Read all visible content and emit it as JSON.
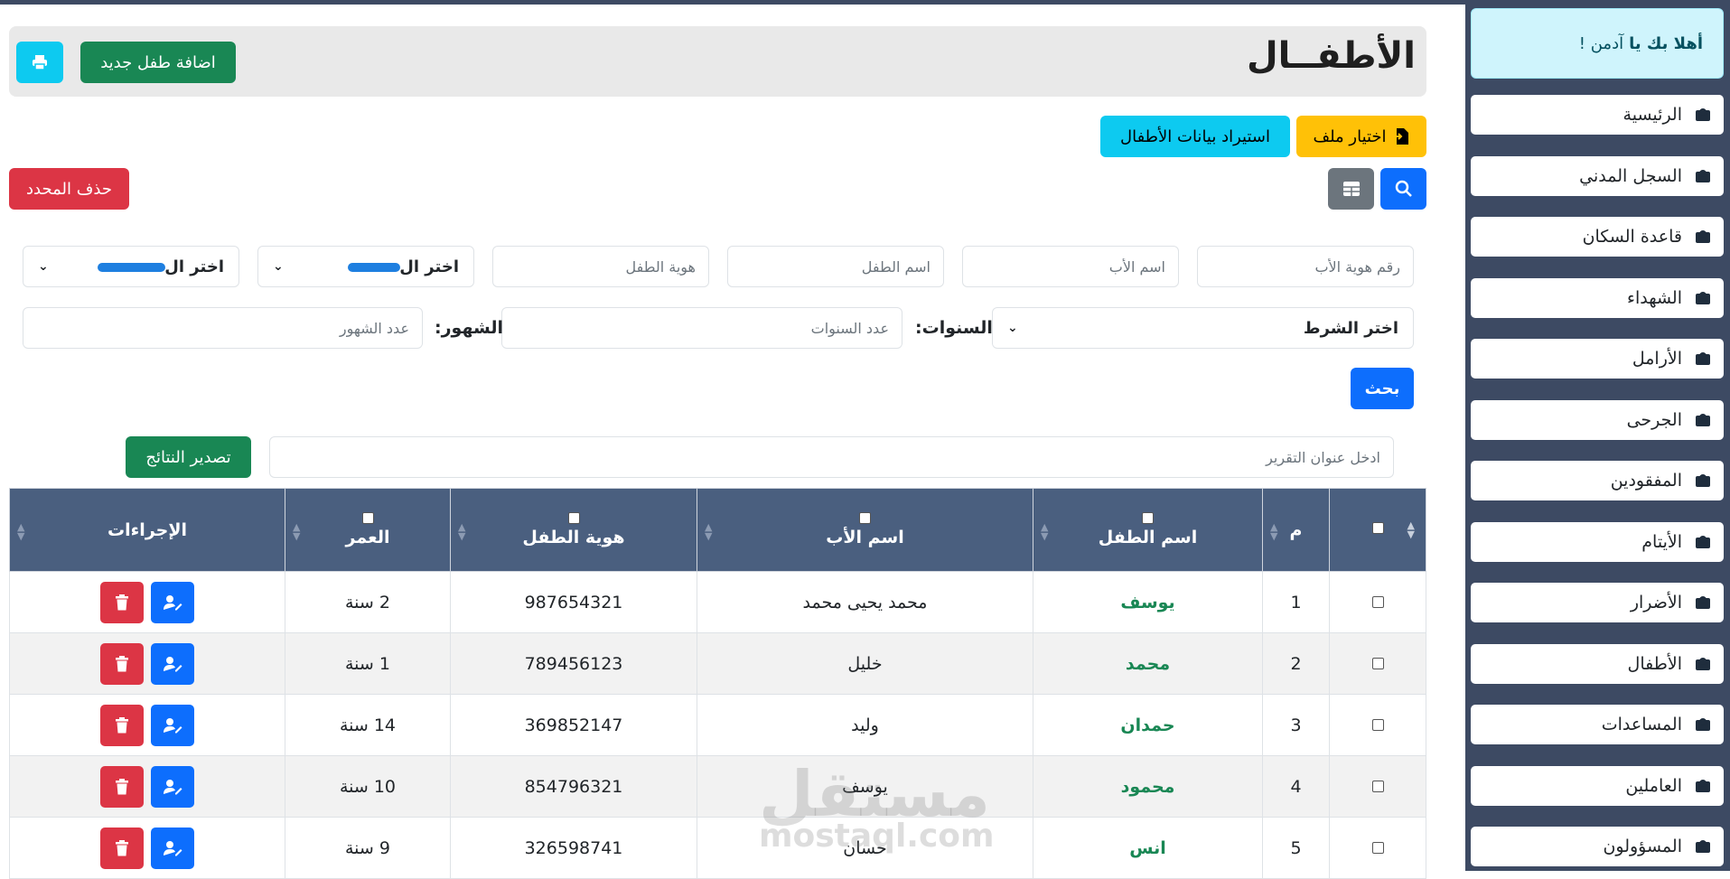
{
  "sidebar": {
    "welcome_prefix": "أهلا بك يا",
    "welcome_name": "آدمن !",
    "items": [
      {
        "label": "الرئيسية",
        "icon": "house-icon"
      },
      {
        "label": "السجل المدني",
        "icon": "id-card-icon"
      },
      {
        "label": "قاعدة السكان",
        "icon": "people-group-icon"
      },
      {
        "label": "الشهداء",
        "icon": "person-x-icon"
      },
      {
        "label": "الأرامل",
        "icon": "person-dress-icon"
      },
      {
        "label": "الجرحى",
        "icon": "person-injured-icon"
      },
      {
        "label": "المفقودين",
        "icon": "person-question-icon"
      },
      {
        "label": "الأيتام",
        "icon": "children-icon"
      },
      {
        "label": "الأضرار",
        "icon": "house-damage-icon"
      },
      {
        "label": "الأطفال",
        "icon": "children-icon"
      },
      {
        "label": "المساعدات",
        "icon": "hand-holding-heart-icon"
      },
      {
        "label": "العاملين",
        "icon": "user-tie-icon"
      },
      {
        "label": "المسؤولون",
        "icon": "user-badge-icon"
      }
    ]
  },
  "header": {
    "title": "الأطفــال",
    "add_child_label": "اضافة طفل جديد",
    "print_icon": "print-icon"
  },
  "import": {
    "choose_file_label": "اختيار ملف",
    "import_label": "استيراد بيانات الأطفال"
  },
  "toolbar": {
    "delete_selected_label": "حذف المحدد"
  },
  "filters": {
    "father_id_placeholder": "رقم هوية الأب",
    "father_name_placeholder": "اسم الأب",
    "child_name_placeholder": "اسم الطفل",
    "child_id_placeholder": "هوية الطفل",
    "select1_label": "اختر ال",
    "select2_label": "اختر ال",
    "condition_label": "اختر الشرط",
    "years_label": "السنوات:",
    "years_placeholder": "عدد السنوات",
    "months_label": "الشهور:",
    "months_placeholder": "عدد الشهور",
    "search_label": "بحث"
  },
  "report": {
    "title_placeholder": "ادخل عنوان التقرير",
    "export_label": "تصدير النتائج"
  },
  "table": {
    "headers": {
      "index": "م",
      "child_name": "اسم الطفل",
      "father_name": "اسم الأب",
      "child_id": "هوية الطفل",
      "age": "العمر",
      "actions": "الإجراءات"
    },
    "rows": [
      {
        "index": "1",
        "child_name": "يوسف",
        "father_name": "محمد يحيى محمد",
        "child_id": "987654321",
        "age": "2 سنة"
      },
      {
        "index": "2",
        "child_name": "محمد",
        "father_name": "خليل",
        "child_id": "789456123",
        "age": "1 سنة"
      },
      {
        "index": "3",
        "child_name": "حمدان",
        "father_name": "وليد",
        "child_id": "369852147",
        "age": "14 سنة"
      },
      {
        "index": "4",
        "child_name": "محمود",
        "father_name": "يوسف",
        "child_id": "854796321",
        "age": "10 سنة"
      },
      {
        "index": "5",
        "child_name": "انس",
        "father_name": "حسان",
        "child_id": "326598741",
        "age": "9 سنة"
      }
    ]
  },
  "watermark": {
    "logo_text": "مستقل",
    "domain": "mostaql.com"
  },
  "colors": {
    "sidebar_bg": "#3d4a63",
    "table_header": "#4a5f7f",
    "accent_green": "#198754",
    "accent_blue": "#0d6efd",
    "danger": "#dc3545"
  }
}
